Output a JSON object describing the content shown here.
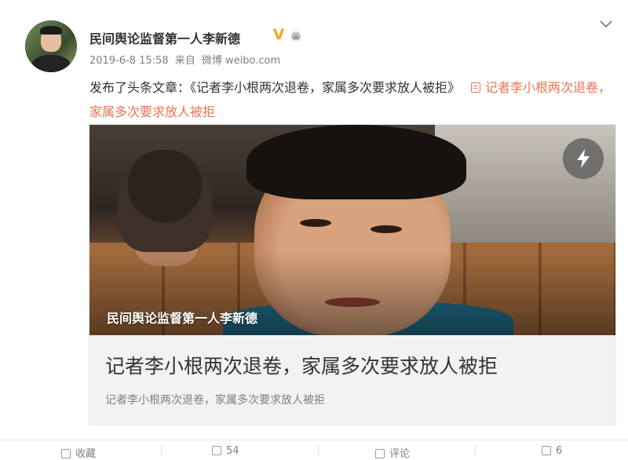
{
  "post": {
    "username": "民间舆论监督第一人李新德",
    "timestamp": "2019-6-8 15:58",
    "source_prefix": "来自",
    "source": "微博 weibo.com",
    "text_prefix": "发布了头条文章：《记者李小根两次退卷，家属多次要求放人被拒》",
    "article_link": "记者李小根两次退卷，家属多次要求放人被拒"
  },
  "card": {
    "image_caption": "民间舆论监督第一人李新德",
    "title": "记者李小根两次退卷，家属多次要求放人被拒",
    "summary": "记者李小根两次退卷，家属多次要求放人被拒"
  },
  "actions": {
    "favorite": "收藏",
    "share": "54",
    "comment": "评论",
    "like": "6"
  },
  "colors": {
    "link": "#eb7350",
    "verified": "#f5a623"
  }
}
